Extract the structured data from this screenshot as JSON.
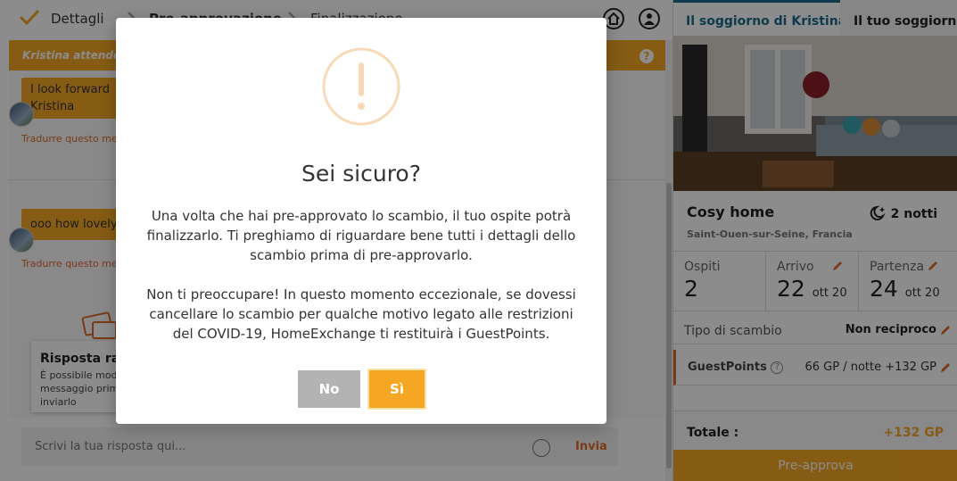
{
  "steps": [
    {
      "label": "Dettagli"
    },
    {
      "label": "Pre-approvazione"
    },
    {
      "label": "Finalizzazione"
    }
  ],
  "banner": {
    "text": "Kristina attende la tua pre-approvazione"
  },
  "messages": [
    {
      "text_line1": "I look forward",
      "text_line2": "Kristina",
      "translate": "Tradurre questo messaggio"
    },
    {
      "text_line1": "ooo how lovely",
      "translate": "Tradurre questo messaggio"
    }
  ],
  "quick_reply": {
    "title": "Risposta rapida",
    "desc": "È possibile modificare il messaggio prima di inviarlo"
  },
  "reply": {
    "placeholder": "Scrivi la tua risposta qui...",
    "send": "Invia"
  },
  "sidebar": {
    "tab_active": "Il soggiorno di Kristina",
    "tab_other": "Il tuo soggiorno",
    "home_name": "Cosy home",
    "nights": "2 notti",
    "location": "Saint-Ouen-sur-Seine, Francia",
    "guests_label": "Ospiti",
    "guests_value": "2",
    "arrival_label": "Arrivo",
    "arrival_day": "22",
    "arrival_month": "ott 20",
    "departure_label": "Partenza",
    "departure_day": "24",
    "departure_month": "ott 20",
    "exchange_type_label": "Tipo di scambio",
    "exchange_type_value": "Non reciproco",
    "gp_label": "GuestPoints",
    "gp_value": "66 GP / notte +132 GP",
    "total_label": "Totale :",
    "total_value": "+132 GP",
    "preapprove": "Pre-approva"
  },
  "modal": {
    "title": "Sei sicuro?",
    "paragraph1": "Una volta che hai pre-approvato lo scambio, il tuo ospite potrà finalizzarlo. Ti preghiamo di riguardare bene tutti i dettagli dello scambio prima di pre-approvarlo.",
    "paragraph2": "Non ti preoccupare! In questo momento eccezionale, se dovessi cancellare lo scambio per qualche motivo legato alle restrizioni del COVID-19, HomeExchange ti restituirà i GuestPoints.",
    "btn_no": "No",
    "btn_yes": "Sì"
  },
  "colors": {
    "accent": "#f5a623",
    "link": "#e06b2a",
    "tab": "#1a6a8a"
  },
  "icons": [
    "check-icon",
    "chevron-right-icon",
    "home-icon",
    "user-icon",
    "help-icon",
    "moon-icon",
    "pencil-icon",
    "info-icon",
    "emoji-icon",
    "warning-icon"
  ]
}
